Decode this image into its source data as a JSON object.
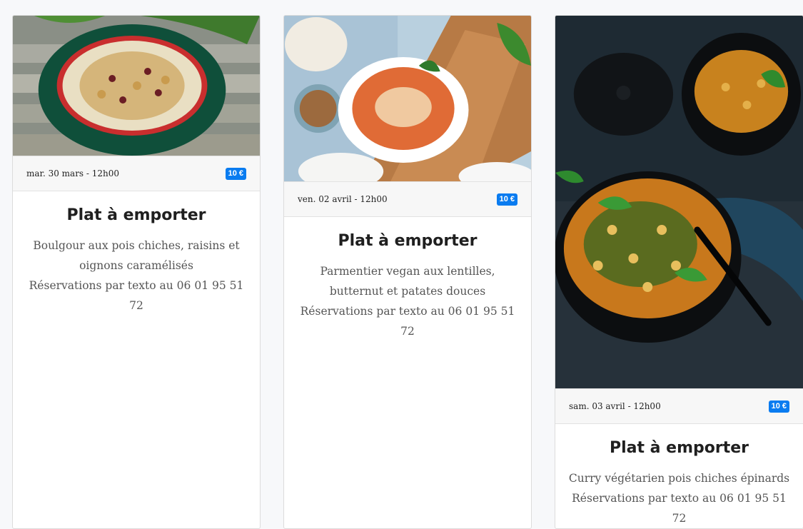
{
  "cards": [
    {
      "image_alt": "Bowl of bulgur with chickpeas, raisins and caramelized onions",
      "date": "mar. 30 mars - 12h00",
      "price": "10 €",
      "title": "Plat à emporter",
      "desc_lines": [
        "Boulgour aux pois chiches, raisins et",
        "oignons caramélisés",
        "Réservations par texto au 06 01 95 51 72"
      ]
    },
    {
      "image_alt": "Vegan lentil shepherd's pie in a white dish",
      "date": "ven. 02 avril - 12h00",
      "price": "10 €",
      "title": "Plat à emporter",
      "desc_lines": [
        "Parmentier vegan aux lentilles,",
        "butternut et patates douces",
        "Réservations par texto au 06 01 95 51 72"
      ]
    },
    {
      "image_alt": "Chickpea spinach vegetarian curry in dark bowls",
      "date": "sam. 03 avril - 12h00",
      "price": "10 €",
      "title": "Plat à emporter",
      "desc_lines": [
        "Curry végétarien pois chiches épinards",
        "Réservations par texto au 06 01 95 51 72"
      ]
    }
  ]
}
